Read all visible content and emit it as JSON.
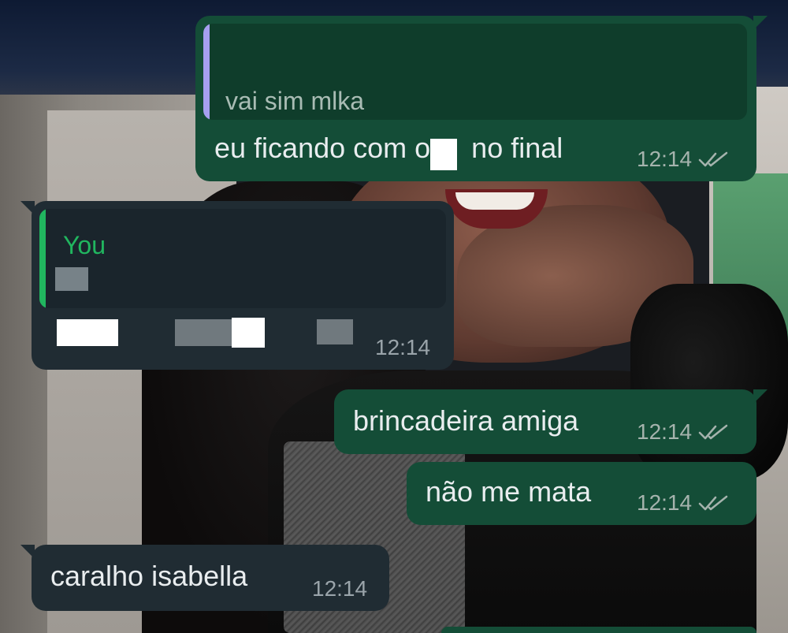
{
  "messages": [
    {
      "id": "m1",
      "direction": "outgoing",
      "quote": {
        "author": "",
        "text": "vai sim mlka"
      },
      "text_before": "eu ficando com o",
      "text_after": "no final",
      "time": "12:14",
      "status": "read"
    },
    {
      "id": "m2",
      "direction": "incoming",
      "quote": {
        "author": "You",
        "text": ""
      },
      "text": "",
      "time": "12:14"
    },
    {
      "id": "m3",
      "direction": "outgoing",
      "text": "brincadeira amiga",
      "time": "12:14",
      "status": "read"
    },
    {
      "id": "m4",
      "direction": "outgoing",
      "text": "não me mata",
      "time": "12:14",
      "status": "read"
    },
    {
      "id": "m5",
      "direction": "incoming",
      "text": "caralho isabella",
      "time": "12:14"
    }
  ],
  "colors": {
    "outgoing_bubble": "#144d37",
    "incoming_bubble": "#202c33",
    "quote_bar_outgoing": "#a69ff0",
    "quote_bar_incoming": "#21b65f",
    "quote_author_you": "#21b65f",
    "read_ticks": "#a5b3ad"
  },
  "icons": {
    "read_receipt": "double-check-icon"
  }
}
